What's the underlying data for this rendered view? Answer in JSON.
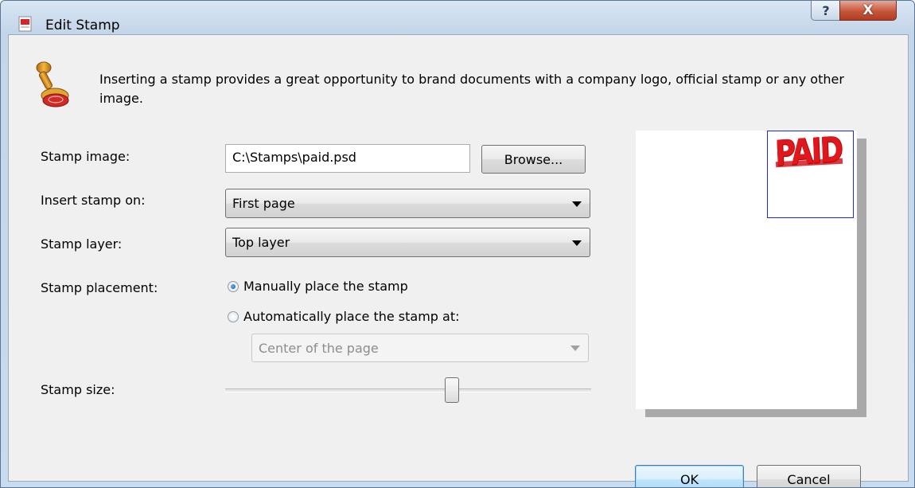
{
  "window": {
    "title": "Edit Stamp",
    "help_label": "?",
    "close_label": "X"
  },
  "intro": "Inserting a stamp provides a great opportunity to brand documents with a company logo, official stamp or any other image.",
  "form": {
    "image_label": "Stamp image:",
    "image_value": "C:\\Stamps\\paid.psd",
    "browse_label": "Browse...",
    "insert_label": "Insert stamp on:",
    "insert_value": "First page",
    "layer_label": "Stamp layer:",
    "layer_value": "Top layer",
    "placement_label": "Stamp placement:",
    "placement_manual": "Manually place the stamp",
    "placement_auto": "Automatically place the stamp at:",
    "placement_auto_value": "Center of the page",
    "size_label": "Stamp size:",
    "size_level": 0.62
  },
  "preview": {
    "stamp_text": "PAID"
  },
  "buttons": {
    "ok": "OK",
    "cancel": "Cancel"
  },
  "icons": {
    "title": "stamp-title-icon",
    "header": "rubber-stamp-icon"
  },
  "colors": {
    "stamp_red": "#e0181e",
    "stamp_box_border": "#1c2bd6"
  }
}
